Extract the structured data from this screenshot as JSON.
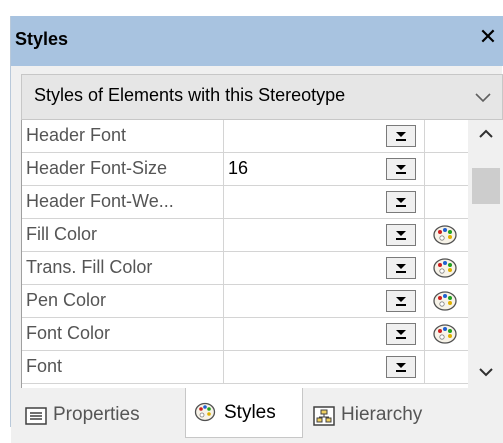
{
  "window": {
    "title": "Styles",
    "close_glyph": "✕"
  },
  "filter": {
    "selected": "Styles of Elements with this Stereotype"
  },
  "properties": [
    {
      "name": "Header Font",
      "value": "",
      "has_palette": false
    },
    {
      "name": "Header Font-Size",
      "value": "16",
      "has_palette": false
    },
    {
      "name": "Header Font-We...",
      "value": "",
      "has_palette": false
    },
    {
      "name": "Fill Color",
      "value": "",
      "has_palette": true
    },
    {
      "name": "Trans. Fill Color",
      "value": "",
      "has_palette": true
    },
    {
      "name": "Pen Color",
      "value": "",
      "has_palette": true
    },
    {
      "name": "Font Color",
      "value": "",
      "has_palette": true
    },
    {
      "name": "Font",
      "value": "",
      "has_palette": false
    }
  ],
  "tabs": [
    {
      "label": "Properties",
      "icon": "properties-icon",
      "active": false
    },
    {
      "label": "Styles",
      "icon": "palette-icon",
      "active": true
    },
    {
      "label": "Hierarchy",
      "icon": "hierarchy-icon",
      "active": false
    }
  ],
  "colors": {
    "titlebar": "#a8c3e0",
    "panel_bg": "#f0f0f0",
    "grid_line": "#d4d4d4"
  }
}
